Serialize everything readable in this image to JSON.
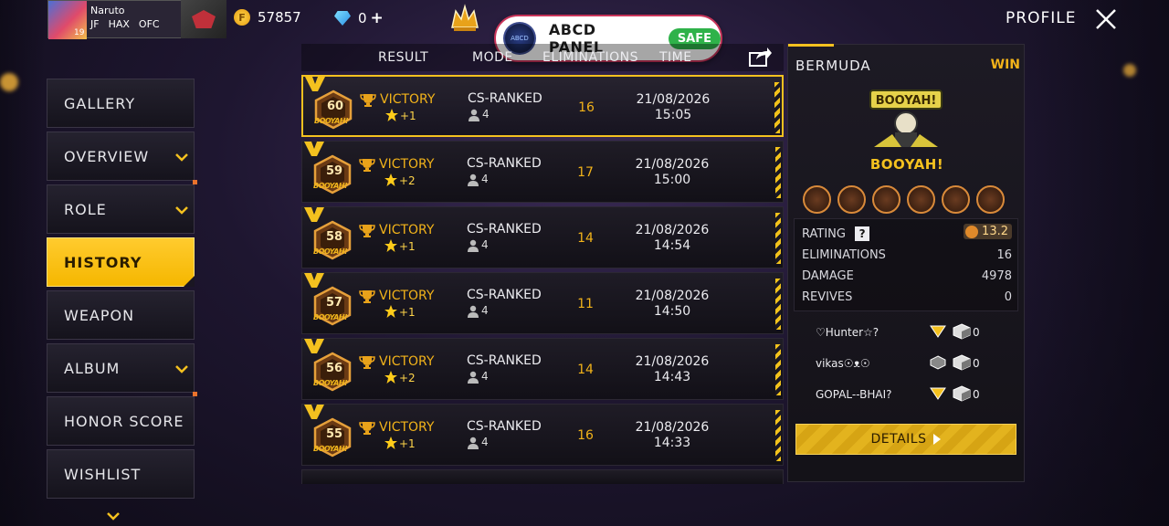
{
  "player": {
    "name": "Naruto",
    "level": "19",
    "tags": [
      "JF",
      "HAX",
      "OFC"
    ]
  },
  "currency": {
    "gold": "57857",
    "diamonds": "0",
    "plus": "+"
  },
  "header": {
    "title": "PROFILE"
  },
  "panel": {
    "title": "ABCD PANEL",
    "status": "SAFE",
    "logo_text": "ABCD"
  },
  "sidebar": {
    "items": [
      {
        "label": "GALLERY"
      },
      {
        "label": "OVERVIEW"
      },
      {
        "label": "ROLE"
      },
      {
        "label": "HISTORY"
      },
      {
        "label": "WEAPON"
      },
      {
        "label": "ALBUM"
      },
      {
        "label": "HONOR SCORE"
      },
      {
        "label": "WISHLIST"
      }
    ]
  },
  "history": {
    "columns": {
      "result": "RESULT",
      "mode": "MODE",
      "eliminations": "ELIMINATIONS",
      "time": "TIME"
    },
    "medal_caption": "BOOYAH!",
    "rows": [
      {
        "rank": "60",
        "result": "VICTORY",
        "delta": "+1",
        "mode": "CS-RANKED",
        "party": "4",
        "elims": "16",
        "date": "21/08/2026",
        "time": "15:05"
      },
      {
        "rank": "59",
        "result": "VICTORY",
        "delta": "+2",
        "mode": "CS-RANKED",
        "party": "4",
        "elims": "17",
        "date": "21/08/2026",
        "time": "15:00"
      },
      {
        "rank": "58",
        "result": "VICTORY",
        "delta": "+1",
        "mode": "CS-RANKED",
        "party": "4",
        "elims": "14",
        "date": "21/08/2026",
        "time": "14:54"
      },
      {
        "rank": "57",
        "result": "VICTORY",
        "delta": "+1",
        "mode": "CS-RANKED",
        "party": "4",
        "elims": "11",
        "date": "21/08/2026",
        "time": "14:50"
      },
      {
        "rank": "56",
        "result": "VICTORY",
        "delta": "+2",
        "mode": "CS-RANKED",
        "party": "4",
        "elims": "14",
        "date": "21/08/2026",
        "time": "14:43"
      },
      {
        "rank": "55",
        "result": "VICTORY",
        "delta": "+1",
        "mode": "CS-RANKED",
        "party": "4",
        "elims": "16",
        "date": "21/08/2026",
        "time": "14:33"
      }
    ]
  },
  "detail": {
    "map": "BERMUDA",
    "outcome": "WIN",
    "art_text": "BOOYAH!",
    "booyah_label": "BOOYAH!",
    "rating_label": "RATING",
    "rating_help": "?",
    "rating_value": "13.2",
    "stats": [
      {
        "label": "ELIMINATIONS",
        "value": "16"
      },
      {
        "label": "DAMAGE",
        "value": "4978"
      },
      {
        "label": "REVIVES",
        "value": "0"
      }
    ],
    "team": [
      {
        "name": "♡Hunter☆?",
        "count": "0"
      },
      {
        "name": "vikas☉ᴥ☉",
        "count": "0"
      },
      {
        "name": "GOPAL--BHAI?",
        "count": "0"
      }
    ],
    "details_button": "DETAILS"
  },
  "colors": {
    "accent": "#f4c11f",
    "safe": "#2fb24a",
    "panel_border": "#c8345a"
  }
}
